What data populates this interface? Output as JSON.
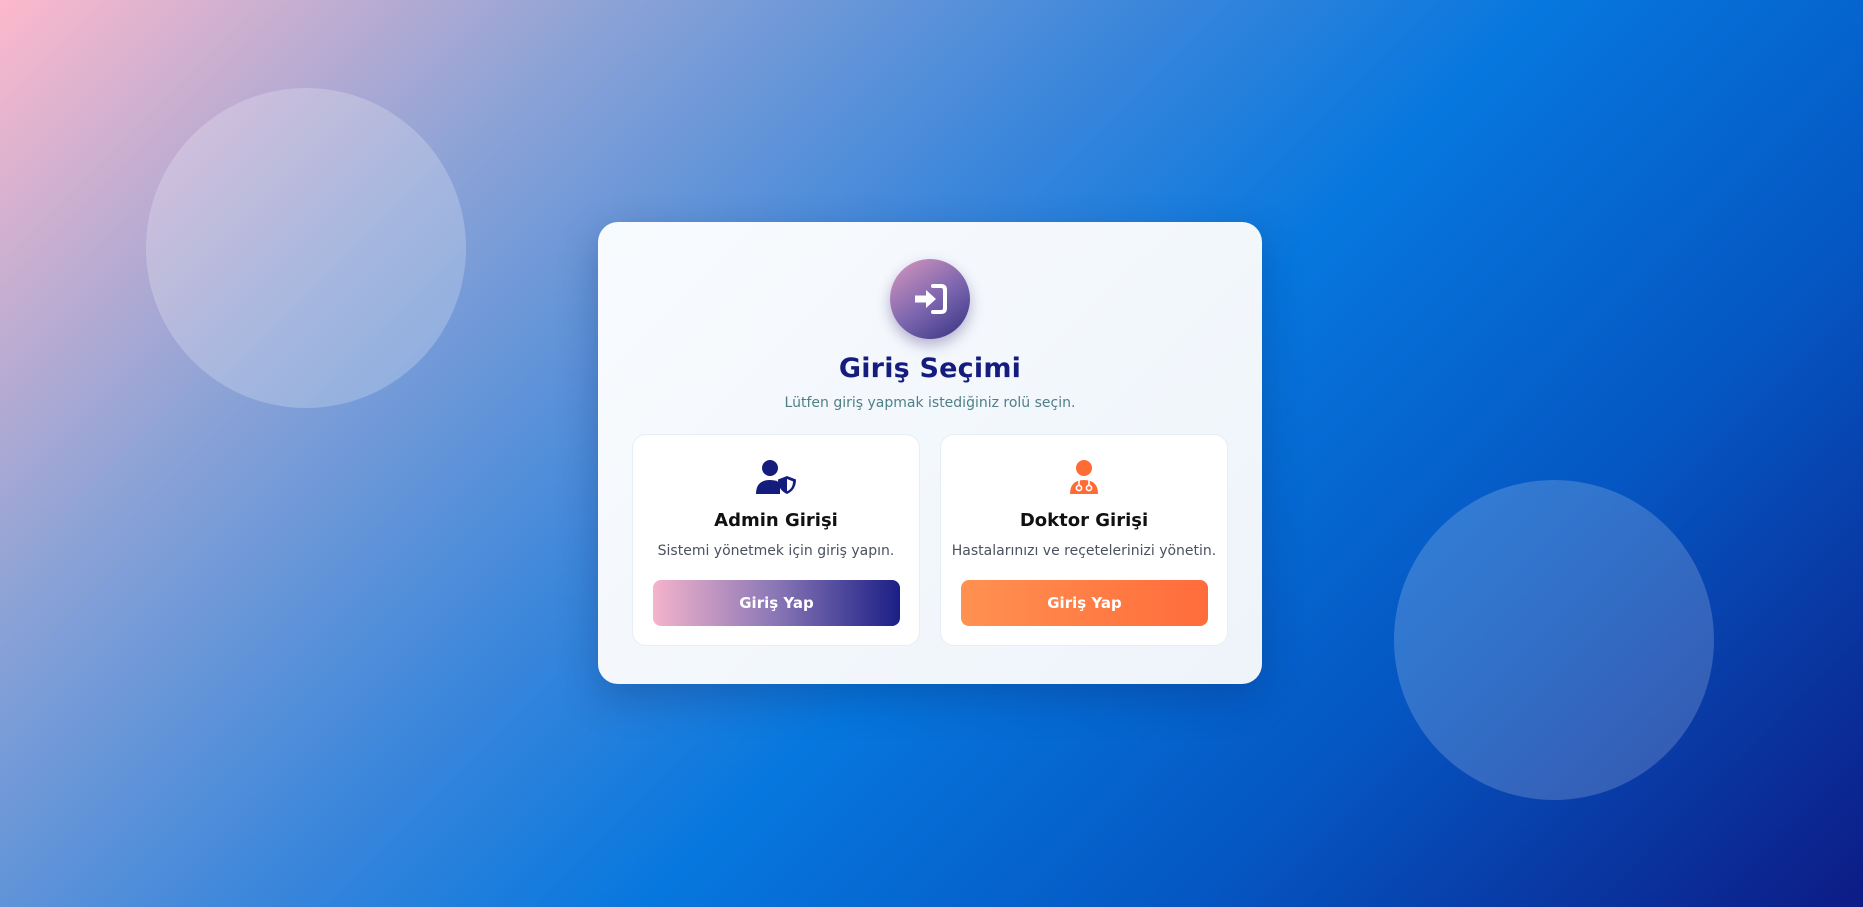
{
  "login_selection": {
    "title": "Giriş Seçimi",
    "subtitle": "Lütfen giriş yapmak istediğiniz rolü seçin.",
    "hero_icon": "sign-in-icon",
    "roles": [
      {
        "title": "Admin Girişi",
        "description": "Sistemi yönetmek için giriş yapın.",
        "button_label": "Giriş Yap",
        "icon": "user-shield-icon",
        "icon_color": "#141c7d"
      },
      {
        "title": "Doktor Girişi",
        "description": "Hastalarınızı ve reçetelerinizi yönetin.",
        "button_label": "Giriş Yap",
        "icon": "user-doctor-icon",
        "icon_color": "#ff6b35"
      }
    ]
  },
  "colors": {
    "title": "#141c7d",
    "subtitle": "#4f7f86",
    "admin_accent": "#141c7d",
    "doctor_accent": "#ff6b35"
  }
}
